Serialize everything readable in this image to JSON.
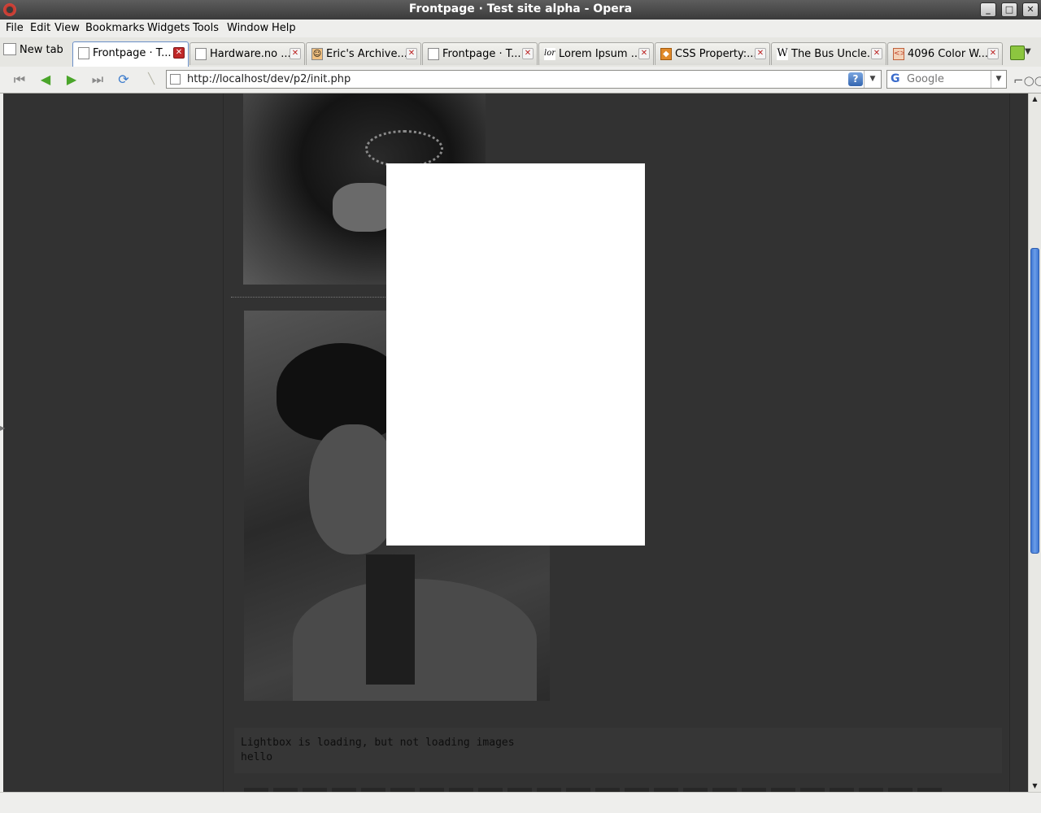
{
  "window": {
    "title": "Frontpage · Test site alpha - Opera",
    "buttons": [
      "minimize",
      "maximize",
      "close"
    ]
  },
  "menubar": {
    "items": [
      "File",
      "Edit",
      "View",
      "Bookmarks",
      "Widgets",
      "Tools",
      "Window",
      "Help"
    ]
  },
  "tabs": {
    "new_tab_label": "New tab",
    "items": [
      {
        "label": "Frontpage · T...",
        "icon": "page-icon",
        "active": true
      },
      {
        "label": "Hardware.no ...",
        "icon": "page-icon",
        "active": false
      },
      {
        "label": "Eric's Archive...",
        "icon": "cat-favicon",
        "active": false
      },
      {
        "label": "Frontpage · T...",
        "icon": "page-icon",
        "active": false
      },
      {
        "label": "Lorem Ipsum ...",
        "icon": "lorem-favicon",
        "active": false
      },
      {
        "label": "CSS Property:...",
        "icon": "fox-favicon",
        "active": false
      },
      {
        "label": "The Bus Uncle...",
        "icon": "wikipedia-favicon",
        "active": false
      },
      {
        "label": "4096 Color W...",
        "icon": "code-favicon",
        "active": false
      }
    ]
  },
  "navbar": {
    "url": "http://localhost/dev/p2/init.php",
    "search_placeholder": "Google",
    "search_engine_glyph": "G",
    "help_glyph": "?"
  },
  "page": {
    "code_lines": [
      "Lightbox is loading, but not loading images",
      "hello"
    ]
  },
  "colors": {
    "page_background": "#323232",
    "lightbox_background": "#ffffff",
    "scroll_thumb": "#3f78d4",
    "active_tab_close": "#c02828"
  }
}
